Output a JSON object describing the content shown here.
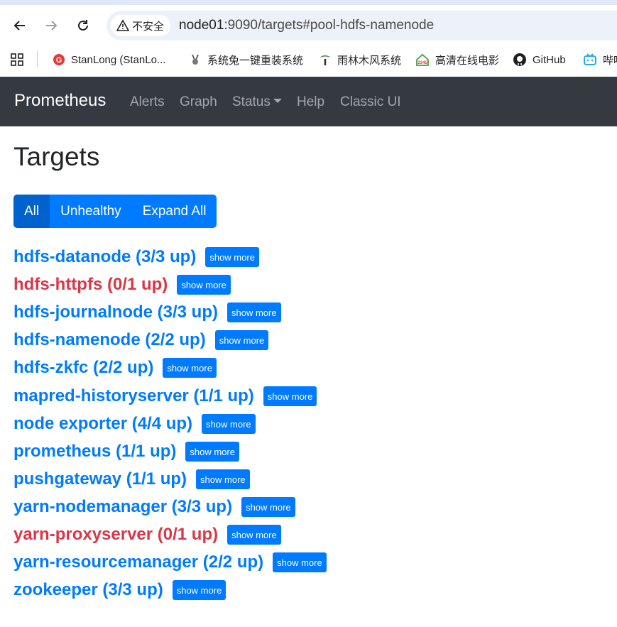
{
  "browser": {
    "security_label": "不安全",
    "url_host": "node01",
    "url_rest": ":9090/targets#pool-hdfs-namenode",
    "bookmarks": [
      {
        "label": "StanLong (StanLo...",
        "icon": "stanlong-icon"
      },
      {
        "label": "系统兔一键重装系统",
        "icon": "rabbit-icon"
      },
      {
        "label": "雨林木风系统",
        "icon": "tree-icon"
      },
      {
        "label": "高清在线电影",
        "icon": "house-2345-icon"
      },
      {
        "label": "GitHub",
        "icon": "github-icon"
      },
      {
        "label": "哔哩",
        "icon": "bilibili-icon"
      }
    ]
  },
  "navbar": {
    "brand": "Prometheus",
    "links": [
      "Alerts",
      "Graph",
      "Status",
      "Help",
      "Classic UI"
    ]
  },
  "page": {
    "title": "Targets",
    "filters": {
      "all": "All",
      "unhealthy": "Unhealthy",
      "expand": "Expand All"
    }
  },
  "targets": [
    {
      "label": "hdfs-datanode (3/3 up)",
      "healthy": true,
      "button": "show more"
    },
    {
      "label": "hdfs-httpfs (0/1 up)",
      "healthy": false,
      "button": "show more"
    },
    {
      "label": "hdfs-journalnode (3/3 up)",
      "healthy": true,
      "button": "show more"
    },
    {
      "label": "hdfs-namenode (2/2 up)",
      "healthy": true,
      "button": "show more"
    },
    {
      "label": "hdfs-zkfc (2/2 up)",
      "healthy": true,
      "button": "show more"
    },
    {
      "label": "mapred-historyserver (1/1 up)",
      "healthy": true,
      "button": "show more"
    },
    {
      "label": "node exporter (4/4 up)",
      "healthy": true,
      "button": "show more"
    },
    {
      "label": "prometheus (1/1 up)",
      "healthy": true,
      "button": "show more"
    },
    {
      "label": "pushgateway (1/1 up)",
      "healthy": true,
      "button": "show more"
    },
    {
      "label": "yarn-nodemanager (3/3 up)",
      "healthy": true,
      "button": "show more"
    },
    {
      "label": "yarn-proxyserver (0/1 up)",
      "healthy": false,
      "button": "show more"
    },
    {
      "label": "yarn-resourcemanager (2/2 up)",
      "healthy": true,
      "button": "show more"
    },
    {
      "label": "zookeeper (3/3 up)",
      "healthy": true,
      "button": "show more"
    }
  ],
  "colors": {
    "healthy": "#007bff",
    "unhealthy": "#dc3545",
    "navbar": "#343a40"
  }
}
